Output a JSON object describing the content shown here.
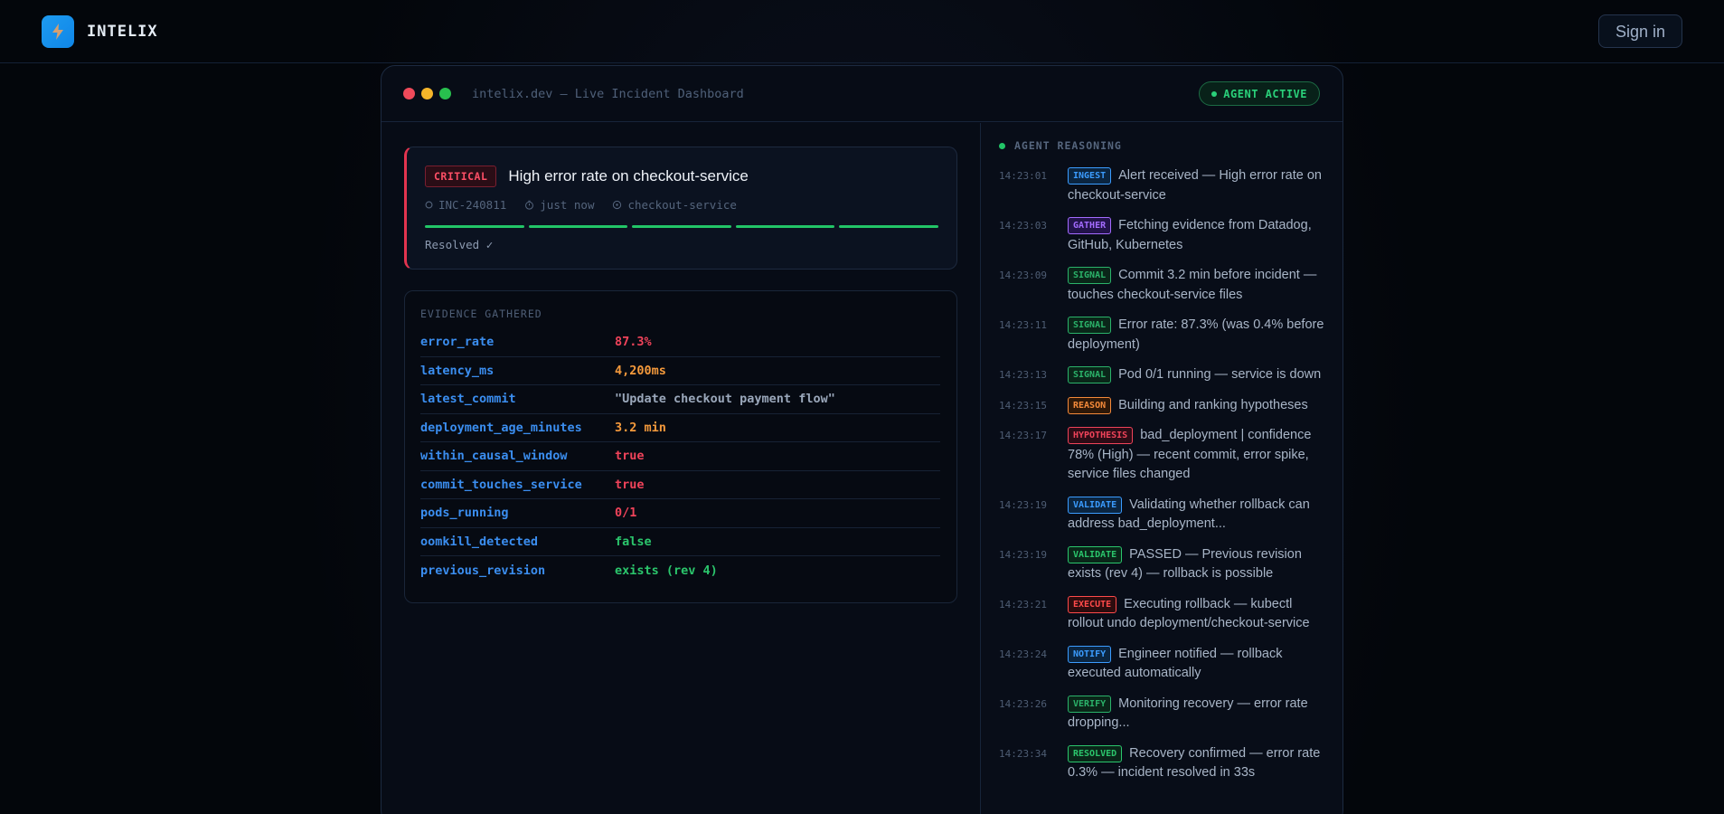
{
  "header": {
    "brand": "INTELIX",
    "signin_label": "Sign in"
  },
  "window": {
    "title": "intelix.dev — Live Incident Dashboard",
    "agent_status": "AGENT ACTIVE"
  },
  "incident": {
    "severity": "CRITICAL",
    "title": "High error rate on checkout-service",
    "id": "INC-240811",
    "time": "just now",
    "service": "checkout-service",
    "progress_completed": 5,
    "progress_total": 5,
    "status": "Resolved ✓"
  },
  "evidence": {
    "title": "EVIDENCE GATHERED",
    "rows": [
      {
        "key": "error_rate",
        "value": "87.3%",
        "color": "#f0435a"
      },
      {
        "key": "latency_ms",
        "value": "4,200ms",
        "color": "#f59a3c"
      },
      {
        "key": "latest_commit",
        "value": "\"Update checkout payment flow\"",
        "color": "#9aa7ba"
      },
      {
        "key": "deployment_age_minutes",
        "value": "3.2 min",
        "color": "#f59a3c"
      },
      {
        "key": "within_causal_window",
        "value": "true",
        "color": "#f0435a"
      },
      {
        "key": "commit_touches_service",
        "value": "true",
        "color": "#f0435a"
      },
      {
        "key": "pods_running",
        "value": "0/1",
        "color": "#f0435a"
      },
      {
        "key": "oomkill_detected",
        "value": "false",
        "color": "#2bc66c"
      },
      {
        "key": "previous_revision",
        "value": "exists (rev 4)",
        "color": "#2bc66c"
      }
    ]
  },
  "reasoning": {
    "title": "AGENT REASONING",
    "steps": [
      {
        "time": "14:23:01",
        "tag": "INGEST",
        "tag_color": "#3b9cff",
        "tag_bg": "#0b2540",
        "text": "Alert received — High error rate on checkout-service"
      },
      {
        "time": "14:23:03",
        "tag": "GATHER",
        "tag_color": "#a36bff",
        "tag_bg": "#22134a",
        "text": "Fetching evidence from Datadog, GitHub, Kubernetes"
      },
      {
        "time": "14:23:09",
        "tag": "SIGNAL",
        "tag_color": "#2bb36a",
        "tag_bg": "#0a2619",
        "text": "Commit 3.2 min before incident — touches checkout-service files"
      },
      {
        "time": "14:23:11",
        "tag": "SIGNAL",
        "tag_color": "#2bb36a",
        "tag_bg": "#0a2619",
        "text": "Error rate: 87.3% (was 0.4% before deployment)"
      },
      {
        "time": "14:23:13",
        "tag": "SIGNAL",
        "tag_color": "#2bb36a",
        "tag_bg": "#0a2619",
        "text": "Pod 0/1 running — service is down"
      },
      {
        "time": "14:23:15",
        "tag": "REASON",
        "tag_color": "#f58a3a",
        "tag_bg": "#2e1808",
        "text": "Building and ranking hypotheses"
      },
      {
        "time": "14:23:17",
        "tag": "HYPOTHESIS",
        "tag_color": "#f0435a",
        "tag_bg": "#2c0c16",
        "text": "bad_deployment | confidence 78% (High) — recent commit, error spike, service files changed"
      },
      {
        "time": "14:23:19",
        "tag": "VALIDATE",
        "tag_color": "#3b9cff",
        "tag_bg": "#0b2540",
        "text": "Validating whether rollback can address bad_deployment..."
      },
      {
        "time": "14:23:19",
        "tag": "VALIDATE",
        "tag_color": "#2bc66c",
        "tag_bg": "#0a2619",
        "text": "PASSED — Previous revision exists (rev 4) — rollback is possible"
      },
      {
        "time": "14:23:21",
        "tag": "EXECUTE",
        "tag_color": "#ff4a4a",
        "tag_bg": "#2c0c0e",
        "text": "Executing rollback — kubectl rollout undo deployment/checkout-service"
      },
      {
        "time": "14:23:24",
        "tag": "NOTIFY",
        "tag_color": "#3b9cff",
        "tag_bg": "#0b2540",
        "text": "Engineer notified — rollback executed automatically"
      },
      {
        "time": "14:23:26",
        "tag": "VERIFY",
        "tag_color": "#2bb36a",
        "tag_bg": "#0a2619",
        "text": "Monitoring recovery — error rate dropping..."
      },
      {
        "time": "14:23:34",
        "tag": "RESOLVED",
        "tag_color": "#2bc66c",
        "tag_bg": "#0a2619",
        "text": "Recovery confirmed — error rate 0.3% — incident resolved in 33s"
      }
    ]
  }
}
